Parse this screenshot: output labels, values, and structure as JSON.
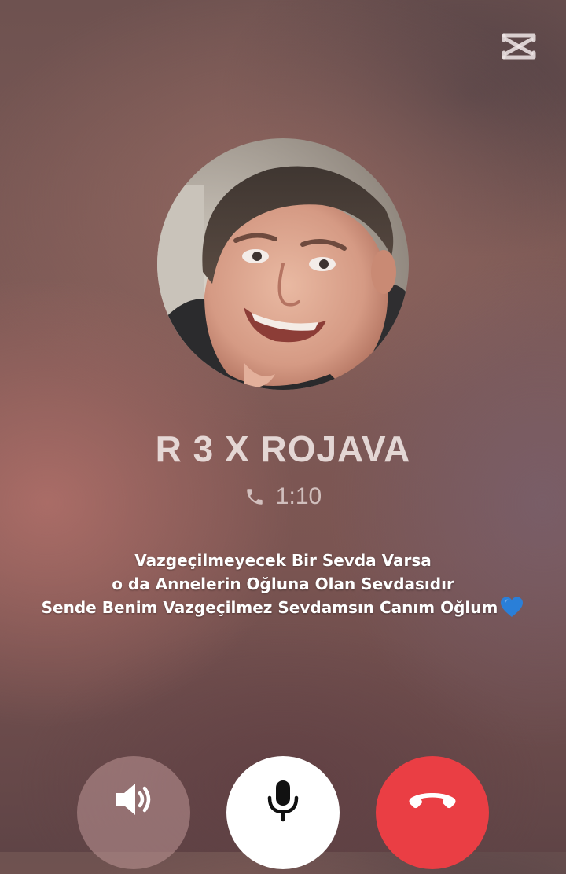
{
  "app": {
    "logo_icon": "capcut-logo-icon"
  },
  "caller": {
    "name": "R 3 X ROJAVA",
    "avatar_icon": "contact-photo"
  },
  "call": {
    "status_icon": "phone-icon",
    "duration": "1:10"
  },
  "caption": {
    "lines": [
      "Vazgeçilmeyecek Bir Sevda Varsa",
      "o da Annelerin Oğluna Olan Sevdasıdır",
      "Sende Benim Vazgeçilmez Sevdamsın Canım Oğlum"
    ],
    "trailing_emoji": "blue-heart-icon"
  },
  "controls": {
    "speaker_icon": "speaker-icon",
    "mute_icon": "microphone-icon",
    "end_call_icon": "end-call-icon"
  },
  "colors": {
    "end_call": "#ea3e44",
    "mute_background": "#ffffff",
    "heart": "#2a7fd8"
  }
}
